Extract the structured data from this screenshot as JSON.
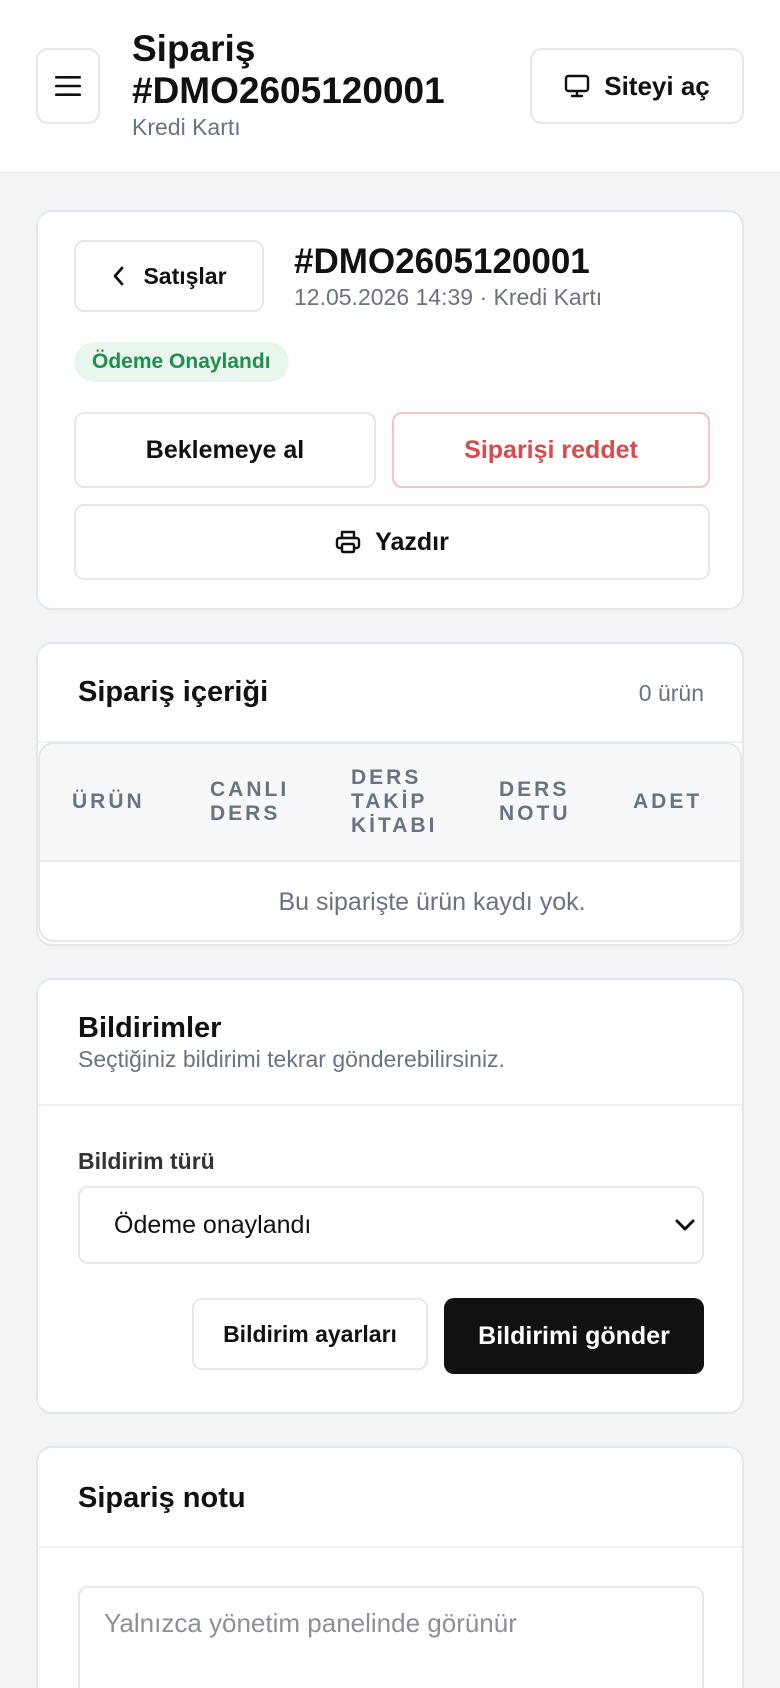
{
  "header": {
    "title": "Sipariş #DMO2605120001",
    "subtitle": "Kredi Kartı",
    "open_site_label": "Siteyi aç"
  },
  "order": {
    "back_label": "Satışlar",
    "id": "#DMO2605120001",
    "meta": "12.05.2026 14:39 · Kredi Kartı",
    "status": "Ödeme Onaylandı",
    "status_color": "#1f8f4e",
    "hold_label": "Beklemeye al",
    "reject_label": "Siparişi reddet",
    "reject_color": "#d94a4a",
    "print_label": "Yazdır"
  },
  "contents": {
    "title": "Sipariş içeriği",
    "count": "0 ürün",
    "columns": [
      "ÜRÜN",
      "CANLI DERS",
      "DERS TAKİP KİTABI",
      "DERS NOTU",
      "ADET"
    ],
    "empty_message": "Bu siparişte ürün kaydı yok."
  },
  "notifications": {
    "title": "Bildirimler",
    "subtitle": "Seçtiğiniz bildirimi tekrar gönderebilirsiniz.",
    "type_label": "Bildirim türü",
    "selected_type": "Ödeme onaylandı",
    "settings_label": "Bildirim ayarları",
    "send_label": "Bildirimi gönder"
  },
  "note": {
    "title": "Sipariş notu",
    "placeholder": "Yalnızca yönetim panelinde görünür"
  },
  "icons": {
    "menu": "hamburger-menu-icon",
    "monitor": "monitor-icon",
    "back": "chevron-left-icon",
    "print": "printer-icon",
    "select": "chevron-down-icon"
  }
}
